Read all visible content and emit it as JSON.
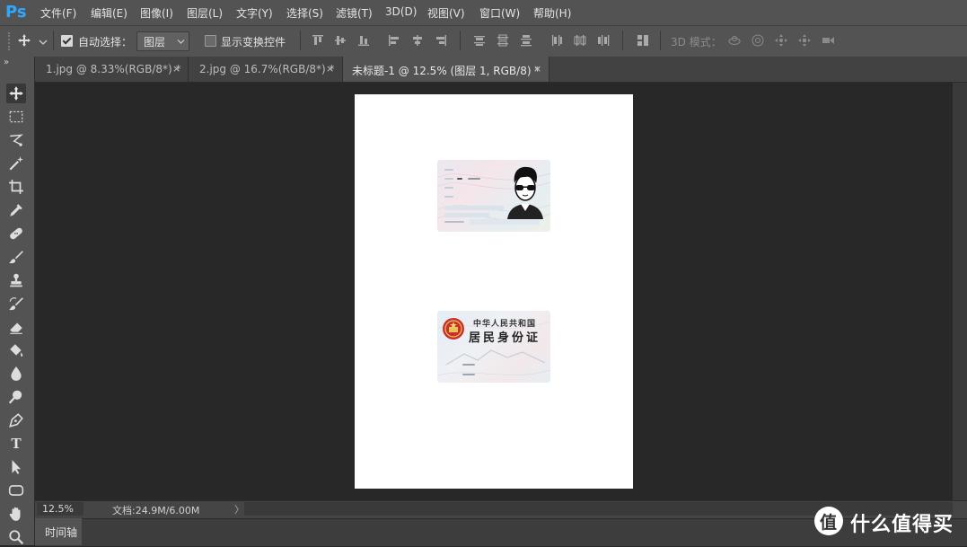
{
  "app": {
    "logo": "Ps"
  },
  "menu": [
    "文件(F)",
    "编辑(E)",
    "图像(I)",
    "图层(L)",
    "文字(Y)",
    "选择(S)",
    "滤镜(T)",
    "3D(D)",
    "视图(V)",
    "窗口(W)",
    "帮助(H)"
  ],
  "options": {
    "auto_select_label": "自动选择：",
    "auto_select_checked": true,
    "layer_select_value": "图层",
    "show_transform_label": "显示变换控件",
    "show_transform_checked": false,
    "mode_3d_label": "3D 模式："
  },
  "tabs": [
    {
      "label": "1.jpg @ 8.33%(RGB/8*) *",
      "close": "×",
      "active": false
    },
    {
      "label": "2.jpg @ 16.7%(RGB/8*) *",
      "close": "×",
      "active": false
    },
    {
      "label": "未标题-1 @ 12.5% (图层 1, RGB/8) *",
      "close": "×",
      "active": true
    }
  ],
  "toolbar": {
    "collapse": "»",
    "tools": [
      "move-tool",
      "marquee-tool",
      "lasso-tool",
      "magic-wand-tool",
      "crop-tool",
      "eyedropper-tool",
      "healing-brush-tool",
      "brush-tool",
      "clone-stamp-tool",
      "history-brush-tool",
      "eraser-tool",
      "paint-bucket-tool",
      "blur-tool",
      "dodge-tool",
      "pen-tool",
      "type-tool",
      "path-selection-tool",
      "shape-tool",
      "hand-tool",
      "zoom-tool"
    ],
    "type_tool_glyph": "T"
  },
  "id_card_back": {
    "title_top": "中华人民共和国",
    "title_main": "居民身份证"
  },
  "status": {
    "zoom": "12.5%",
    "doc_info": "文档:24.9M/6.00M",
    "arrow": "〉"
  },
  "timeline": {
    "label": "时间轴"
  },
  "watermark": {
    "logo_glyph": "值",
    "text": "什么值得买"
  },
  "colors": {
    "accent": "#31a8ff",
    "panel": "#535353",
    "workspace": "#282828"
  }
}
